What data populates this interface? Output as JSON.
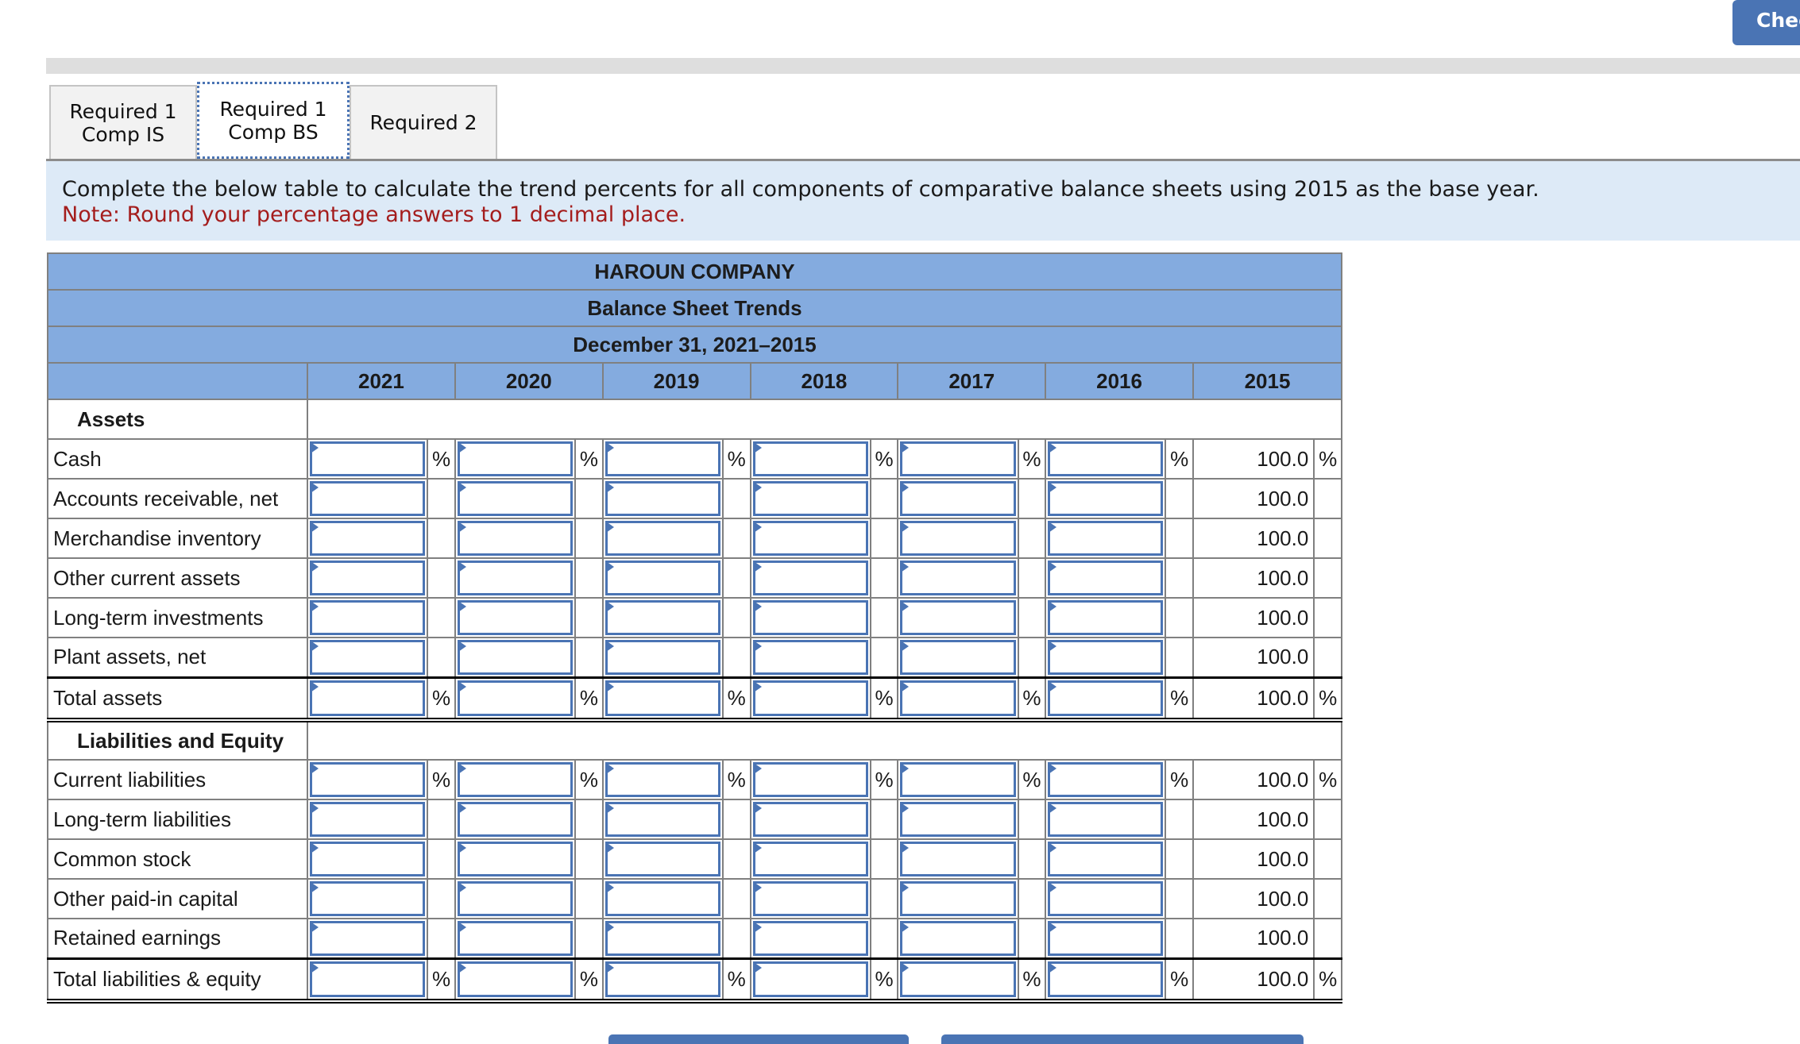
{
  "header": {
    "check_button_label": "Check"
  },
  "tabs": [
    {
      "label": "Required 1\nComp IS",
      "active": false
    },
    {
      "label": "Required 1\nComp BS",
      "active": true
    },
    {
      "label": "Required 2",
      "active": false
    }
  ],
  "instructions": {
    "text": "Complete the below table to calculate the trend percents for all components of comparative balance sheets using 2015 as the base year.",
    "note": "Note: Round your percentage answers to 1 decimal place."
  },
  "table": {
    "company": "HAROUN COMPANY",
    "title": "Balance Sheet Trends",
    "period": "December 31, 2021–2015",
    "years": [
      "2021",
      "2020",
      "2019",
      "2018",
      "2017",
      "2016",
      "2015"
    ],
    "percent_symbol": "%",
    "sections": {
      "assets": "Assets",
      "liabilities": "Liabilities and Equity"
    },
    "asset_rows": [
      {
        "label": "Cash",
        "base": "100.0",
        "show_pct": true,
        "total": false
      },
      {
        "label": "Accounts receivable, net",
        "base": "100.0",
        "show_pct": false,
        "total": false
      },
      {
        "label": "Merchandise inventory",
        "base": "100.0",
        "show_pct": false,
        "total": false
      },
      {
        "label": "Other current assets",
        "base": "100.0",
        "show_pct": false,
        "total": false
      },
      {
        "label": "Long-term investments",
        "base": "100.0",
        "show_pct": false,
        "total": false
      },
      {
        "label": "Plant assets, net",
        "base": "100.0",
        "show_pct": false,
        "total": false
      },
      {
        "label": "Total assets",
        "base": "100.0",
        "show_pct": true,
        "total": true
      }
    ],
    "liability_rows": [
      {
        "label": "Current liabilities",
        "base": "100.0",
        "show_pct": true,
        "total": false
      },
      {
        "label": "Long-term liabilities",
        "base": "100.0",
        "show_pct": false,
        "total": false
      },
      {
        "label": "Common stock",
        "base": "100.0",
        "show_pct": false,
        "total": false
      },
      {
        "label": "Other paid-in capital",
        "base": "100.0",
        "show_pct": false,
        "total": false
      },
      {
        "label": "Retained earnings",
        "base": "100.0",
        "show_pct": false,
        "total": false
      },
      {
        "label": "Total liabilities & equity",
        "base": "100.0",
        "show_pct": true,
        "total": true
      }
    ],
    "input_values": ""
  },
  "colors": {
    "accent": "#4a74b4",
    "header_bg": "#84abdf",
    "note": "#a41d1d",
    "instr_bg": "#ddeaf7"
  }
}
